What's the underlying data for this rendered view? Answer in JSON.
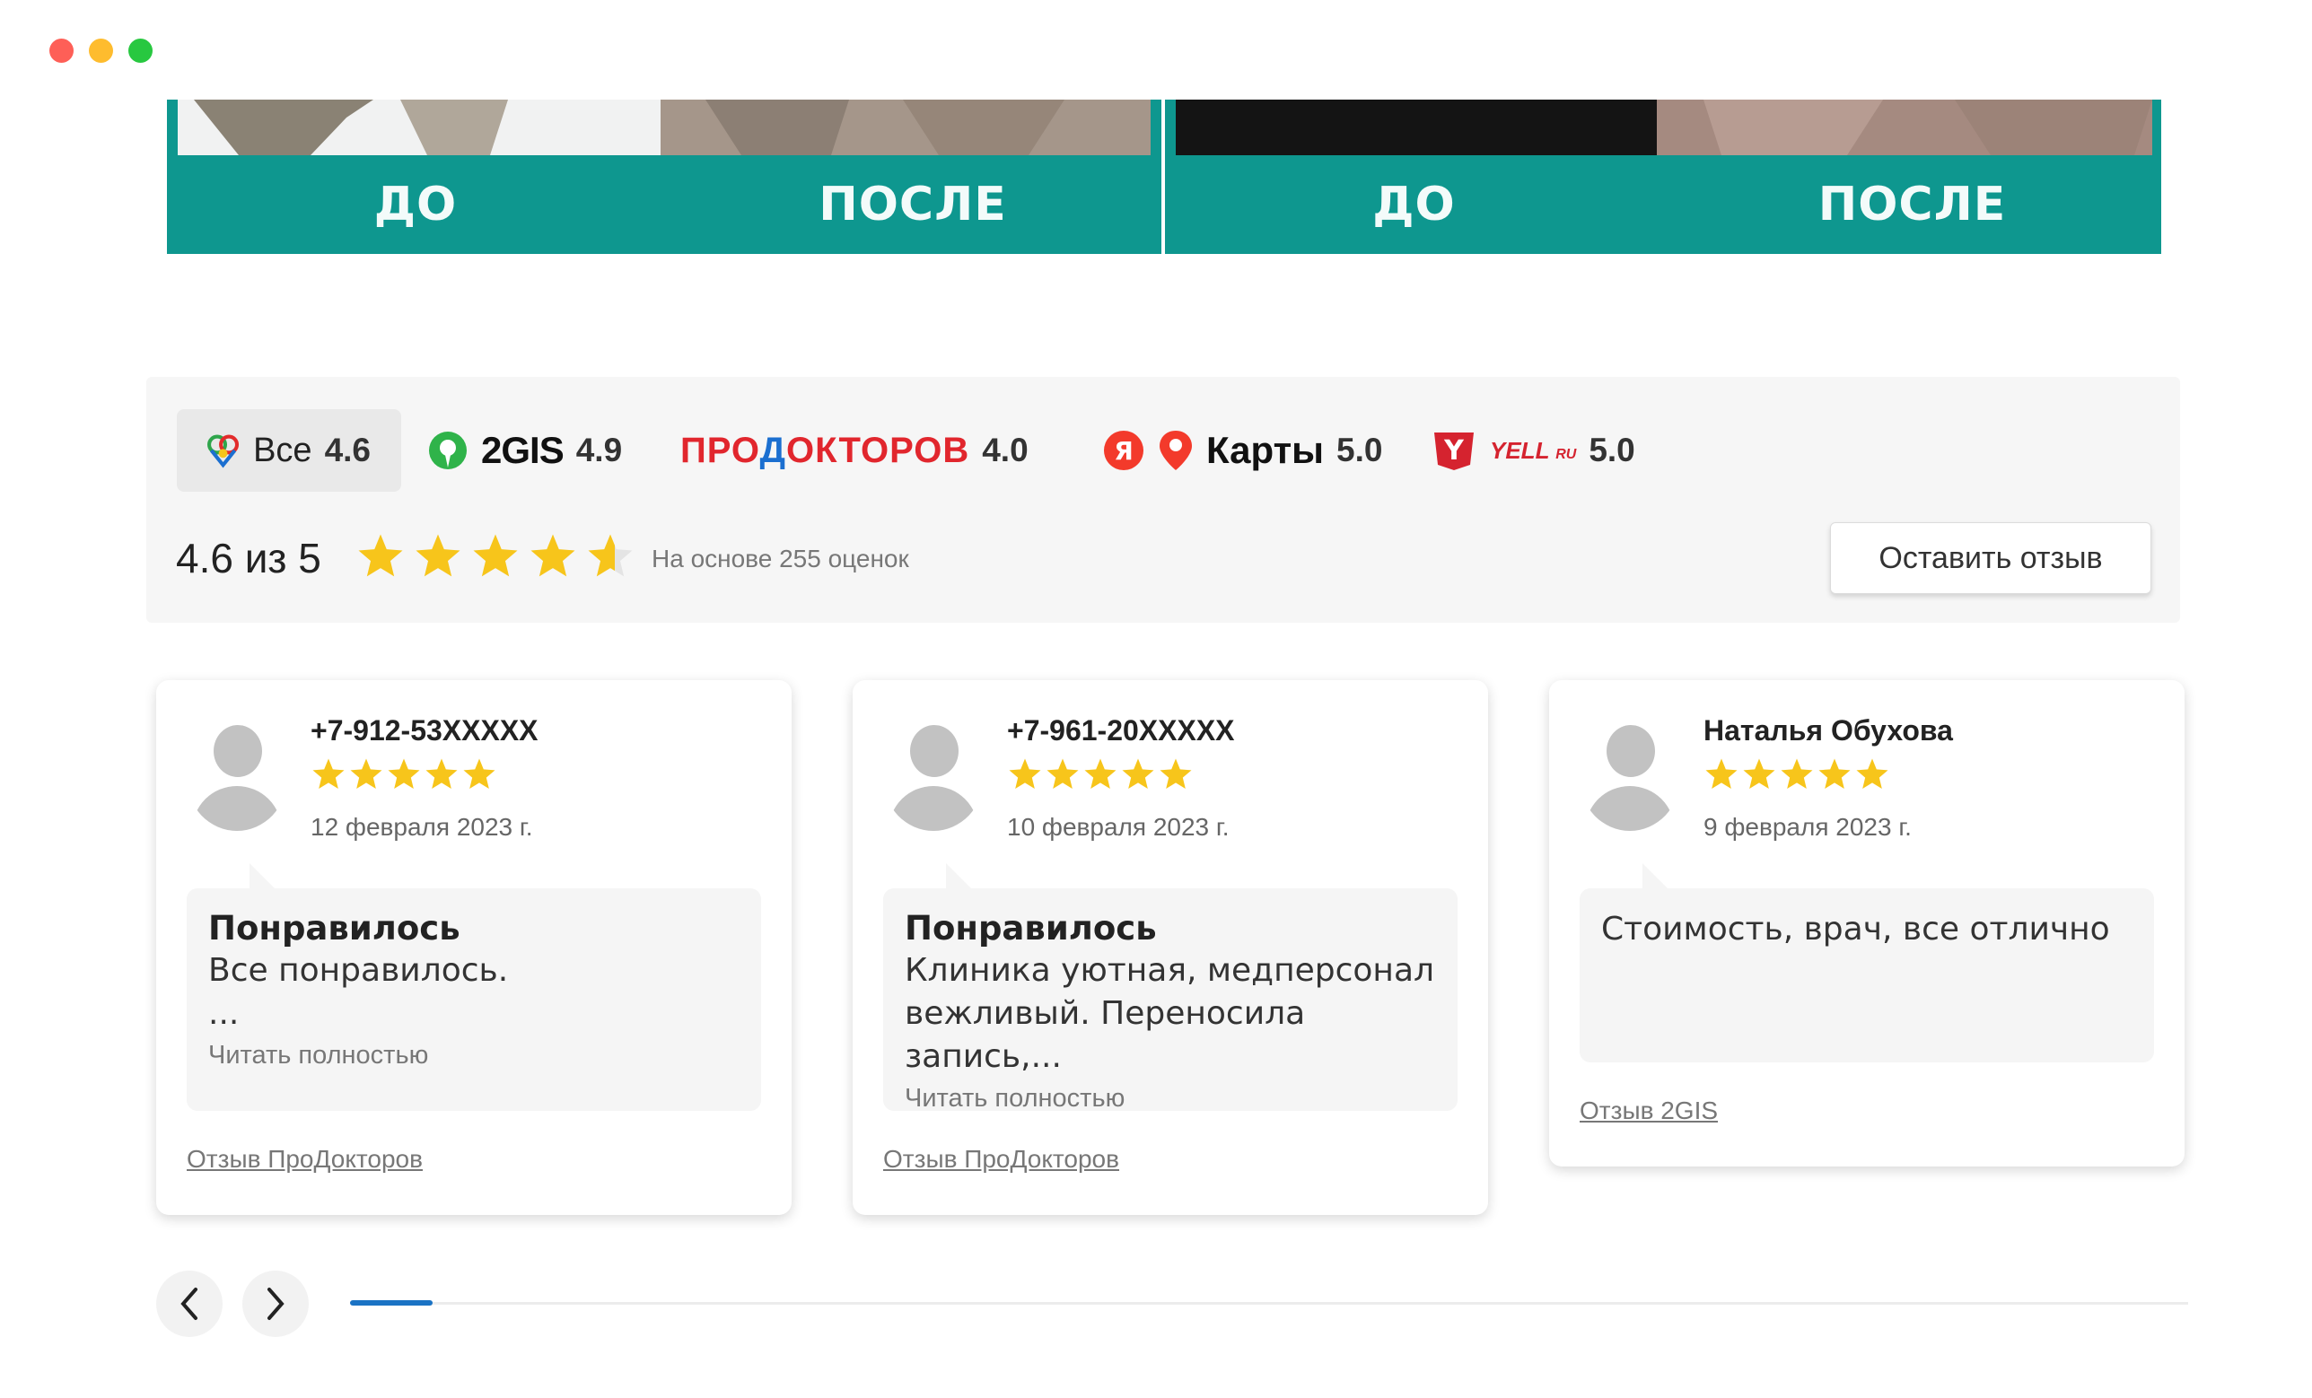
{
  "banners": [
    {
      "before_label": "ДО",
      "after_label": "ПОСЛЕ"
    },
    {
      "before_label": "ДО",
      "after_label": "ПОСЛЕ"
    }
  ],
  "colors": {
    "banner": "#0e978f",
    "star": "#f7c51b",
    "progress": "#1b73c4",
    "prodoktorov_red": "#e1262d",
    "prodoktorov_blue": "#1b6fd0",
    "yandex_red": "#f33a2b"
  },
  "sources": [
    {
      "name": "Все",
      "rating": "4.6",
      "icon": "multi-color-heart-icon",
      "active": true
    },
    {
      "name": "2GIS",
      "rating": "4.9",
      "icon": "2gis-logo"
    },
    {
      "name": "ПРОДОКТОРОВ",
      "rating": "4.0",
      "icon": "prodoktorov-logo"
    },
    {
      "name": "Карты",
      "rating": "5.0",
      "icon": "yandex-maps-logo"
    },
    {
      "name": "YELL",
      "suffix": "RU",
      "rating": "5.0",
      "icon": "yell-logo"
    }
  ],
  "summary": {
    "score_text": "4.6 из 5",
    "stars": 4.6,
    "based_on": "На основе 255 оценок",
    "leave_review_label": "Оставить отзыв"
  },
  "reviews": [
    {
      "author": "+7-912-53XXXXX",
      "stars": 5,
      "date": "12 февраля 2023 г.",
      "title": "Понравилось",
      "text_lines": [
        "Все понравилось.",
        "..."
      ],
      "read_more": "Читать полностью",
      "source": "Отзыв ПроДокторов"
    },
    {
      "author": "+7-961-20XXXXX",
      "stars": 5,
      "date": "10 февраля 2023 г.",
      "title": "Понравилось",
      "text_lines": [
        "Клиника уютная, медперсонал",
        "вежливый. Переносила запись,..."
      ],
      "read_more": "Читать полностью",
      "source": "Отзыв ПроДокторов"
    },
    {
      "author": "Наталья Обухова",
      "stars": 5,
      "date": "9 февраля 2023 г.",
      "title": "",
      "text_lines": [
        "Стоимость, врач, все отлично"
      ],
      "read_more": "",
      "source": "Отзыв 2GIS"
    }
  ],
  "carousel": {
    "progress": 0.045,
    "prev_icon": "chevron-left-icon",
    "next_icon": "chevron-right-icon"
  }
}
